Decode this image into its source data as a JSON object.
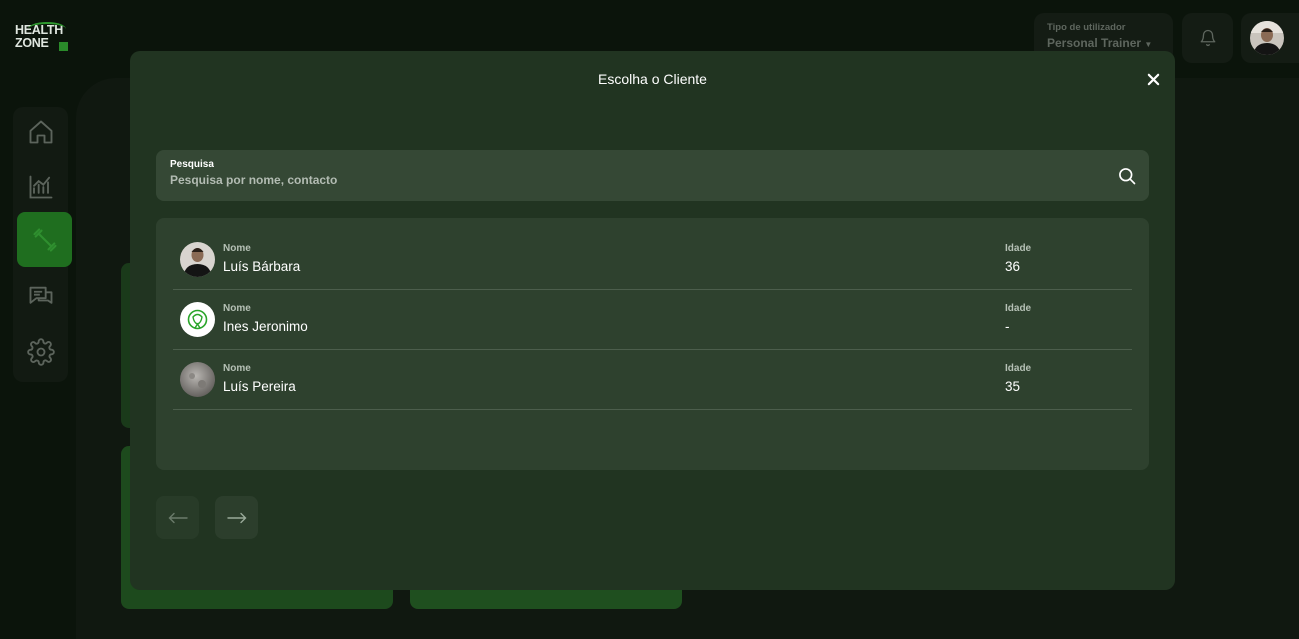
{
  "app": {
    "logo_line1": "HEALTH",
    "logo_line2": "ZONE"
  },
  "header": {
    "user_type_label": "Tipo de utilizador",
    "user_type_value": "Personal Trainer"
  },
  "sidebar": {
    "items": [
      {
        "icon": "home-icon"
      },
      {
        "icon": "chart-icon"
      },
      {
        "icon": "dumbbell-icon",
        "active": true
      },
      {
        "icon": "chat-icon"
      },
      {
        "icon": "gear-icon"
      }
    ]
  },
  "modal": {
    "title": "Escolha o Cliente",
    "search": {
      "label": "Pesquisa",
      "placeholder": "Pesquisa por nome, contacto"
    },
    "name_label": "Nome",
    "age_label": "Idade",
    "clients": [
      {
        "name": "Luís Bárbara",
        "age": "36"
      },
      {
        "name": "Ines Jeronimo",
        "age": "-"
      },
      {
        "name": "Luís Pereira",
        "age": "35"
      }
    ]
  },
  "colors": {
    "accent": "#1f6e1f",
    "modal_bg": "#213421",
    "list_bg": "#2e412e"
  }
}
